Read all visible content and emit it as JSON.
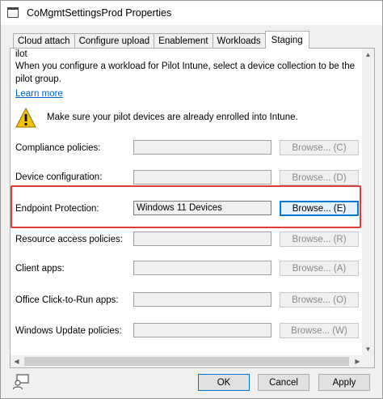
{
  "window": {
    "title": "CoMgmtSettingsProd Properties"
  },
  "tabs": [
    {
      "label": "Cloud attach",
      "active": false
    },
    {
      "label": "Configure upload",
      "active": false
    },
    {
      "label": "Enablement",
      "active": false
    },
    {
      "label": "Workloads",
      "active": false
    },
    {
      "label": "Staging",
      "active": true
    }
  ],
  "staging": {
    "heading": "ilot",
    "description": "When you configure a workload for Pilot Intune, select a device collection to be the pilot group.",
    "learn_more": "Learn more",
    "warning": "Make sure your pilot devices are already enrolled into Intune.",
    "rows": [
      {
        "label": "Compliance policies:",
        "value": "",
        "button": "Browse... (C)",
        "enabled": false
      },
      {
        "label": "Device configuration:",
        "value": "",
        "button": "Browse... (D)",
        "enabled": false
      },
      {
        "label": "Endpoint Protection:",
        "value": "Windows 11 Devices",
        "button": "Browse... (E)",
        "enabled": true
      },
      {
        "label": "Resource access policies:",
        "value": "",
        "button": "Browse... (R)",
        "enabled": false
      },
      {
        "label": "Client apps:",
        "value": "",
        "button": "Browse... (A)",
        "enabled": false
      },
      {
        "label": "Office Click-to-Run apps:",
        "value": "",
        "button": "Browse... (O)",
        "enabled": false
      },
      {
        "label": "Windows Update policies:",
        "value": "",
        "button": "Browse... (W)",
        "enabled": false
      }
    ]
  },
  "footer": {
    "ok": "OK",
    "cancel": "Cancel",
    "apply": "Apply"
  },
  "colors": {
    "highlight": "#e03b3b",
    "link": "#0066cc",
    "accent": "#0078d7",
    "warning": "#f5c400"
  },
  "icons": {
    "title": "window-icon",
    "warning": "warning-icon",
    "footer": "console-user-icon"
  }
}
